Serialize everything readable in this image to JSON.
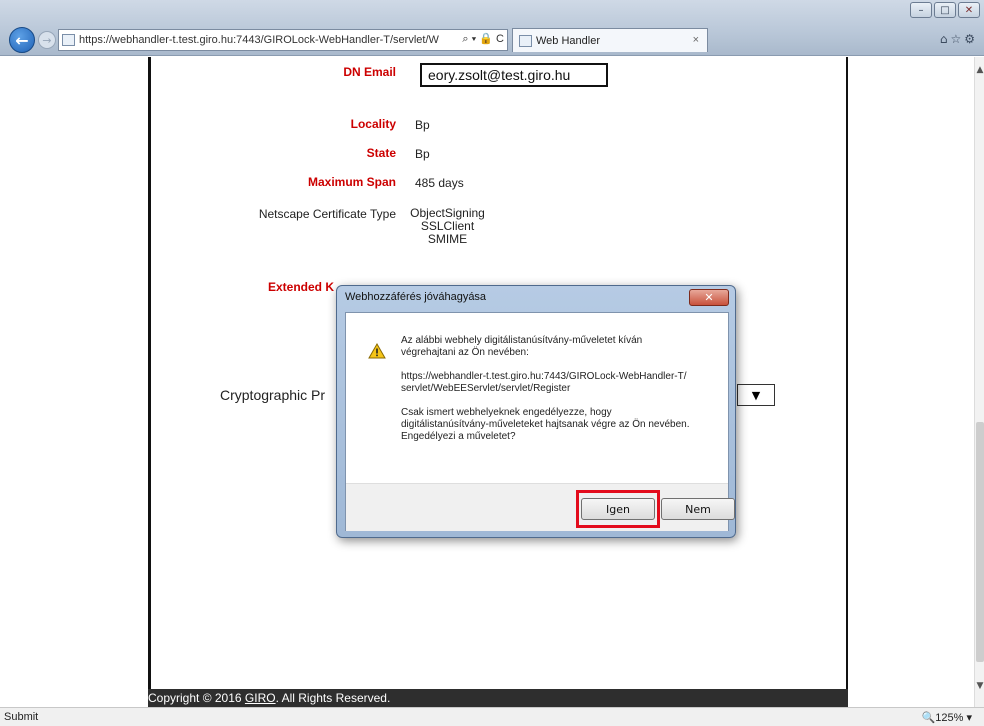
{
  "browser": {
    "url": "https://webhandler-t.test.giro.hu:7443/GIROLock-WebHandler-T/servlet/W",
    "address_tools": "⌕ ▾ 🔒 C",
    "tab_title": "Web Handler",
    "tab_close": "×",
    "window_controls": [
      "–",
      "□",
      "✕"
    ],
    "right_icons": "⌂☆⚙"
  },
  "form": {
    "dn_email_label": "DN Email",
    "dn_email_value": "eory.zsolt@test.giro.hu",
    "locality_label": "Locality",
    "locality_value": "Bp",
    "state_label": "State",
    "state_value": "Bp",
    "max_span_label": "Maximum Span",
    "max_span_value": "485 days",
    "cert_type_label": "Netscape Certificate Type",
    "cert_types": [
      "ObjectSigning",
      "SSLClient",
      "SMIME"
    ],
    "ext_key_label": "Extended K",
    "crypto_label": "Cryptographic Pr"
  },
  "footer": {
    "prefix": "Copyright © 2016 ",
    "link": "GIRO",
    "suffix": ". All Rights Reserved."
  },
  "dialog": {
    "title": "Webhozzáférés jóváhagyása",
    "close": "✕",
    "line1": "Az alábbi webhely digitálistanúsítvány-műveletet kíván",
    "line2": "végrehajtani az Ön nevében:",
    "url1": "https://webhandler-t.test.giro.hu:7443/GIROLock-WebHandler-T/",
    "url2": "servlet/WebEEServlet/servlet/Register",
    "q1": "Csak ismert webhelyeknek engedélyezze, hogy",
    "q2": "digitálistanúsítvány-műveleteket hajtsanak végre az Ön nevében.",
    "q3": "Engedélyezi a műveletet?",
    "yes": "Igen",
    "no": "Nem",
    "highlight_color": "#e30b1c"
  },
  "status": {
    "text": "Submit",
    "zoom": "🔍125%  ▾"
  }
}
